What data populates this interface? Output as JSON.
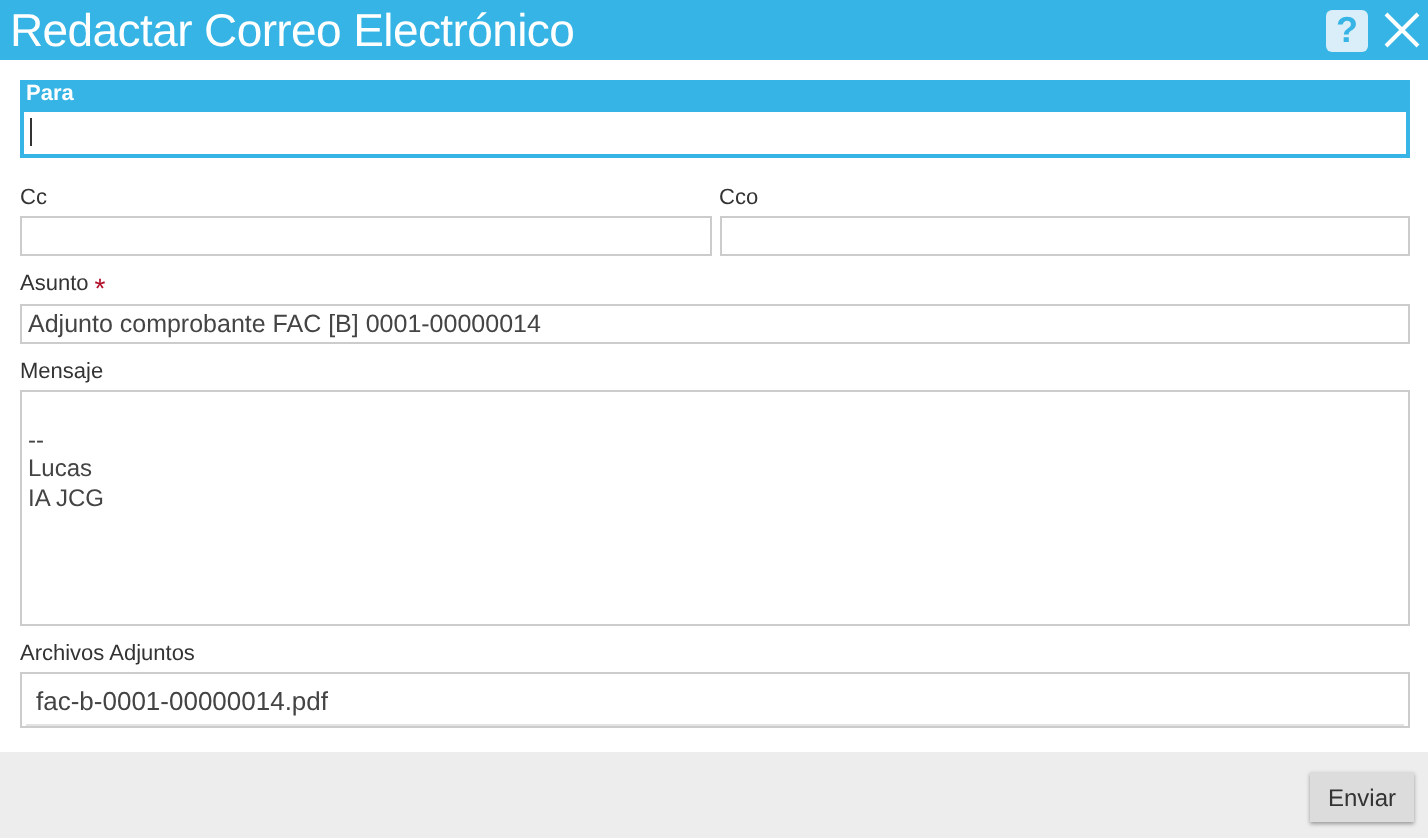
{
  "window": {
    "title": "Redactar Correo Electrónico",
    "help_icon": "?"
  },
  "fields": [
    {
      "kind": "input",
      "label": "Para",
      "focused": true
    },
    {
      "kind": "pair",
      "items": [
        {
          "label": "Cc"
        },
        {
          "label": "Cco"
        }
      ]
    },
    {
      "kind": "input",
      "label": "Asunto",
      "required_mark": "*",
      "value": "Adjunto comprobante FAC [B] 0001-00000014",
      "focused": false
    },
    {
      "kind": "textarea",
      "label": "Mensaje",
      "value": "\n--\nLucas\nIA JCG"
    },
    {
      "kind": "attachments",
      "label": "Archivos Adjuntos",
      "files": [
        "fac-b-0001-00000014.pdf"
      ]
    }
  ],
  "buttons": [
    "Enviar"
  ]
}
